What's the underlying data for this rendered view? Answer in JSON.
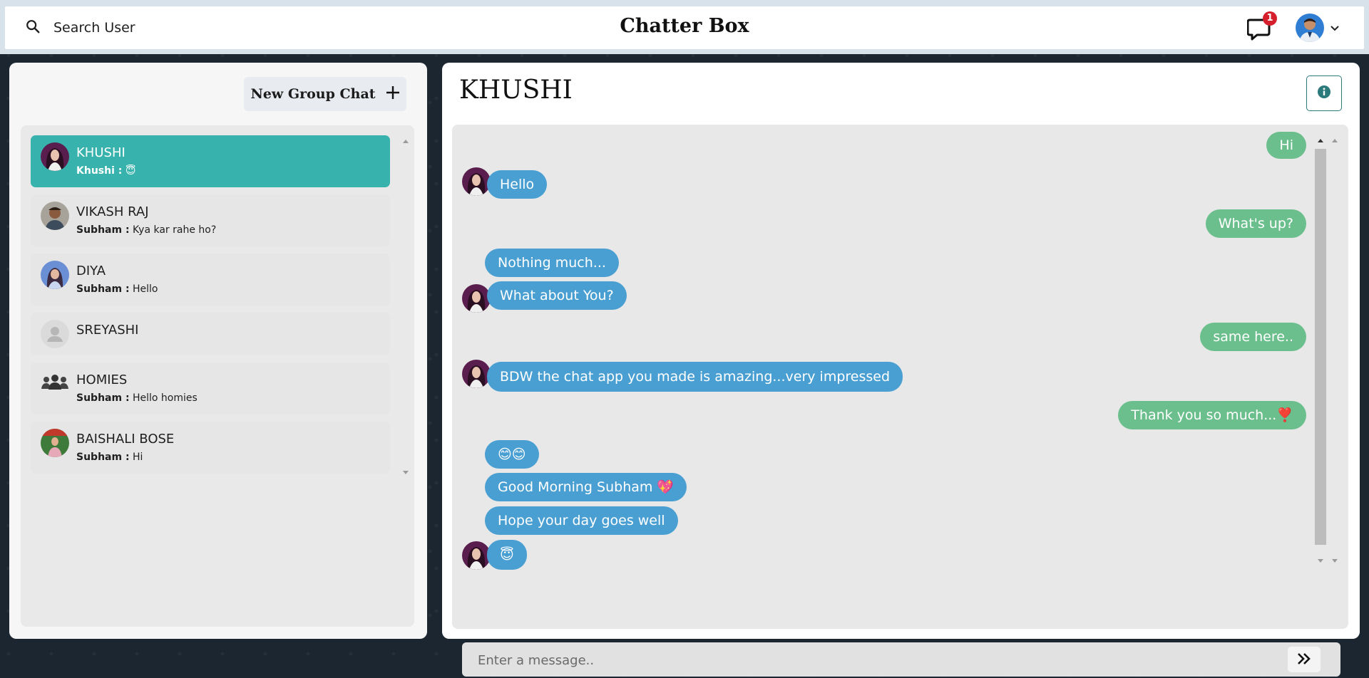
{
  "header": {
    "search_label": "Search User",
    "app_title": "Chatter Box",
    "notification_count": "1"
  },
  "sidebar": {
    "new_group_label": "New Group Chat",
    "chats": [
      {
        "name": "KHUSHI",
        "sender": "Khushi :",
        "message": "😇",
        "active": true,
        "avatar": "photo-girl-purple"
      },
      {
        "name": "VIKASH RAJ",
        "sender": "Subham :",
        "message": "Kya kar rahe ho?",
        "active": false,
        "avatar": "photo-boy"
      },
      {
        "name": "DIYA",
        "sender": "Subham :",
        "message": "Hello",
        "active": false,
        "avatar": "photo-girl-blue"
      },
      {
        "name": "SREYASHI",
        "sender": "",
        "message": "",
        "active": false,
        "avatar": "default-user-icon"
      },
      {
        "name": "HOMIES",
        "sender": "Subham :",
        "message": "Hello homies",
        "active": false,
        "avatar": "group-icon"
      },
      {
        "name": "BAISHALI BOSE",
        "sender": "Subham :",
        "message": "Hi",
        "active": false,
        "avatar": "photo-girl-green"
      }
    ]
  },
  "chat": {
    "title": "KHUSHI",
    "messages": [
      {
        "text": "Hi",
        "from": "me"
      },
      {
        "text": "Hello",
        "from": "them"
      },
      {
        "text": "What's up?",
        "from": "me"
      },
      {
        "text": "Nothing much...",
        "from": "them"
      },
      {
        "text": "What about You?",
        "from": "them"
      },
      {
        "text": "same here..",
        "from": "me"
      },
      {
        "text": "BDW the chat app you made is amazing...very impressed",
        "from": "them"
      },
      {
        "text": "Thank you so much...❣️",
        "from": "me"
      },
      {
        "text": "😊😊",
        "from": "them"
      },
      {
        "text": "Good Morning Subham 💖",
        "from": "them"
      },
      {
        "text": "Hope your day goes well",
        "from": "them"
      },
      {
        "text": "😇",
        "from": "them"
      }
    ],
    "input_placeholder": "Enter a message.."
  },
  "colors": {
    "active_chat": "#38b2ac",
    "incoming_bubble": "#4a9fd2",
    "outgoing_bubble": "#6bbf8c",
    "badge": "#d61f2c"
  }
}
